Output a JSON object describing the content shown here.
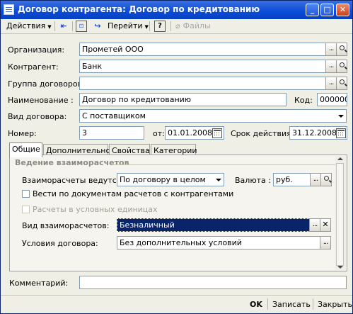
{
  "window": {
    "title": "Договор контрагента: Договор по кредитованию",
    "min": "_",
    "max": "□",
    "close": "✕"
  },
  "toolbar": {
    "actions": "Действия",
    "goto": "Перейти",
    "help": "?",
    "files": "Файлы"
  },
  "form": {
    "org_label": "Организация:",
    "org_value": "Прометей ООО",
    "contr_label": "Контрагент:",
    "contr_value": "Банк",
    "group_label": "Группа договоров:",
    "group_value": "",
    "name_label": "Наименование :",
    "name_value": "Договор по кредитованию",
    "code_label": "Код:",
    "code_value": "000000",
    "kind_label": "Вид договора:",
    "kind_value": "С поставщиком",
    "num_label": "Номер:",
    "num_value": "3",
    "from_label": "от:",
    "from_value": "01.01.2008",
    "term_label": "Срок действия:",
    "term_value": "31.12.2008"
  },
  "tabs": [
    "Общие",
    "Дополнительно",
    "Свойства",
    "Категории"
  ],
  "panel": {
    "section": "Ведение взаиморасчетов",
    "settle_label": "Взаиморасчеты ведутся:",
    "settle_value": "По договору в целом",
    "currency_label": "Валюта :",
    "currency_value": "руб.",
    "chk_docs": "Вести по документам расчетов с контрагентами",
    "chk_units": "Расчеты в условных единицах",
    "type_label": "Вид взаиморасчетов:",
    "type_value": "Безналичный",
    "cond_label": "Условия договора:",
    "cond_value": "Без дополнительных условий"
  },
  "comment_label": "Комментарий:",
  "comment_value": "",
  "footer": {
    "ok": "OK",
    "save": "Записать",
    "close": "Закрыть"
  },
  "colors": {
    "title_bar": "#0a4bd8",
    "selection": "#0a246a",
    "background": "#f0efe6"
  }
}
